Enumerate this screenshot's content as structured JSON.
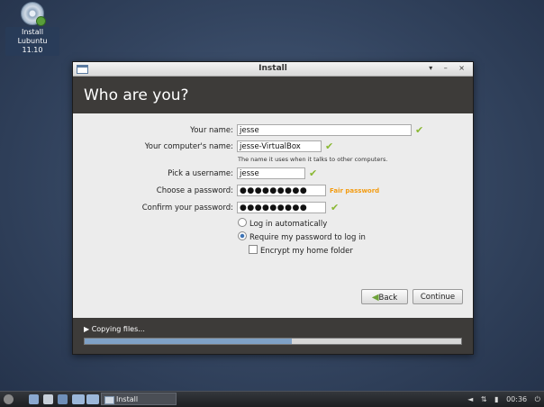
{
  "desktop": {
    "icon_label_line1": "Install",
    "icon_label_line2": "Lubuntu 11.10"
  },
  "window": {
    "title": "Install",
    "controls": "▾ – ×"
  },
  "header": {
    "title": "Who are you?"
  },
  "form": {
    "your_name_label": "Your name:",
    "your_name_value": "jesse",
    "computer_name_label": "Your computer's name:",
    "computer_name_value": "jesse-VirtualBox",
    "computer_name_hint": "The name it uses when it talks to other computers.",
    "username_label": "Pick a username:",
    "username_value": "jesse",
    "password_label": "Choose a password:",
    "password_value": "●●●●●●●●●",
    "password_strength": "Fair password",
    "confirm_label": "Confirm your password:",
    "confirm_value": "●●●●●●●●●",
    "check_glyph": "✔",
    "option_login_auto": "Log in automatically",
    "option_require_password": "Require my password to log in",
    "option_encrypt_home": "Encrypt my home folder",
    "selected_option": "Require my password to log in"
  },
  "buttons": {
    "back_arrow": "◀",
    "back_label": "Back",
    "continue_label": "Continue"
  },
  "progress": {
    "label": "▶ Copying files...",
    "fraction": 0.55
  },
  "taskbar": {
    "task_label": "Install",
    "clock": "00:36",
    "tray_icons": [
      "speaker-icon",
      "network-icon",
      "battery-icon",
      "power-icon"
    ]
  },
  "colors": {
    "accent_check": "#8ab833",
    "strength_fair": "#f39c12",
    "header_bg": "#3d3b39",
    "progress_fill": "#7fa1c6"
  }
}
